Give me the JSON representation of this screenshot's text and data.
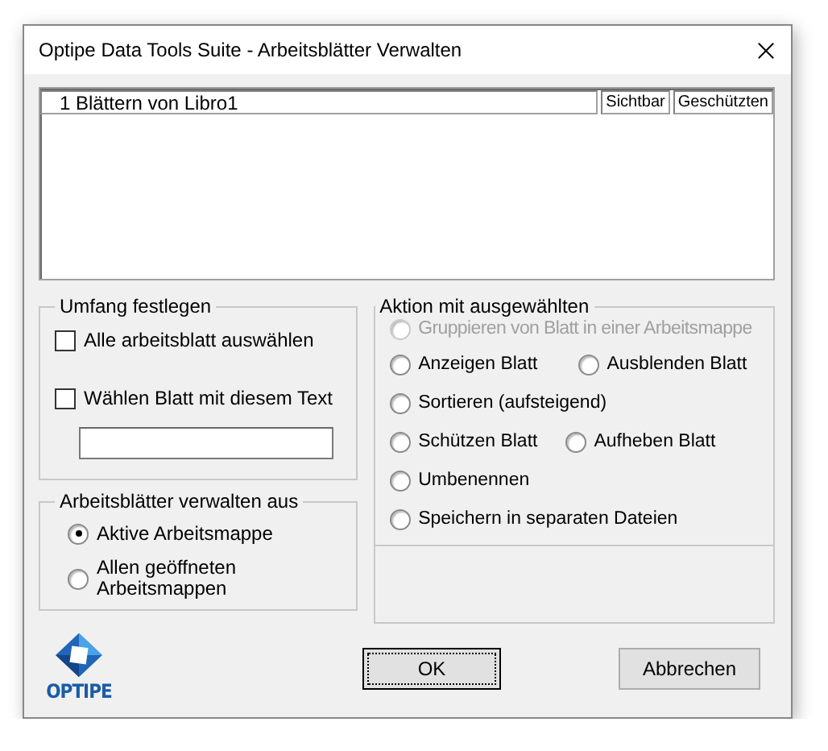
{
  "window": {
    "title": "Optipe Data Tools Suite - Arbeitsblätter Verwalten"
  },
  "sheet_list": {
    "columns": [
      {
        "label": "1 Blättern von Libro1"
      },
      {
        "label": "Sichtbar"
      },
      {
        "label": "Geschützten"
      }
    ]
  },
  "scope": {
    "title": "Umfang festlegen",
    "options": [
      {
        "label": "Alle arbeitsblatt auswählen",
        "checked": false
      },
      {
        "label": "Wählen Blatt mit diesem Text",
        "checked": false
      }
    ]
  },
  "manage_from": {
    "title": "Arbeitsblätter verwalten aus",
    "options": [
      {
        "label": "Aktive Arbeitsmappe",
        "selected": true
      },
      {
        "label": "Allen geöffneten Arbeitsmappen",
        "selected": false
      }
    ]
  },
  "actions": {
    "title": "Aktion mit ausgewählten",
    "rows": [
      {
        "options": [
          {
            "label": "Gruppieren von Blatt in einer Arbeitsmappe",
            "selected": false,
            "disabled": true
          }
        ]
      },
      {
        "options": [
          {
            "label": "Anzeigen Blatt",
            "selected": false,
            "disabled": false
          },
          {
            "label": "Ausblenden Blatt",
            "selected": false,
            "disabled": false
          }
        ]
      },
      {
        "options": [
          {
            "label": "Sortieren (aufsteigend)",
            "selected": false,
            "disabled": false
          }
        ]
      },
      {
        "options": [
          {
            "label": "Schützen Blatt",
            "selected": false,
            "disabled": false
          },
          {
            "label": "Aufheben Blatt",
            "selected": false,
            "disabled": false
          }
        ]
      },
      {
        "options": [
          {
            "label": "Umbenennen",
            "selected": false,
            "disabled": false
          }
        ]
      },
      {
        "options": [
          {
            "label": "Speichern in separaten Dateien",
            "selected": false,
            "disabled": false
          }
        ]
      }
    ]
  },
  "logo": {
    "text": "OPTIPE"
  },
  "buttons": [
    {
      "label": "OK",
      "default": true
    },
    {
      "label": "Abbrechen",
      "default": false
    }
  ]
}
